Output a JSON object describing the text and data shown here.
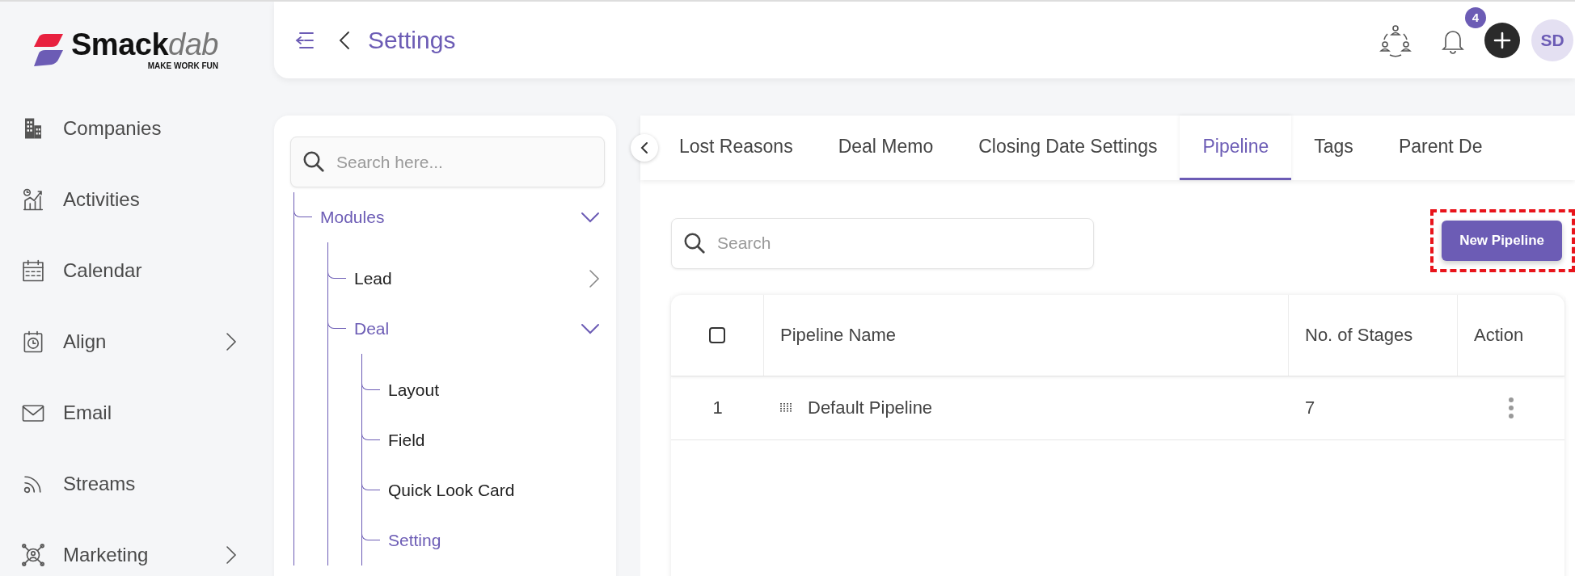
{
  "logo": {
    "name": "Smack",
    "name_accent": "dab",
    "tagline": "MAKE WORK FUN"
  },
  "sidebar": {
    "items": [
      {
        "label": "Companies",
        "expandable": false
      },
      {
        "label": "Activities",
        "expandable": false
      },
      {
        "label": "Calendar",
        "expandable": false
      },
      {
        "label": "Align",
        "expandable": true
      },
      {
        "label": "Email",
        "expandable": false
      },
      {
        "label": "Streams",
        "expandable": false
      },
      {
        "label": "Marketing",
        "expandable": true
      }
    ]
  },
  "header": {
    "title": "Settings",
    "notification_count": "4",
    "avatar_initials": "SD"
  },
  "tree": {
    "search": {
      "placeholder": "Search here..."
    },
    "items": [
      {
        "label": "Modules",
        "expanded": true,
        "children": [
          {
            "label": "Lead",
            "expanded": false
          },
          {
            "label": "Deal",
            "expanded": true,
            "children": [
              {
                "label": "Layout",
                "selected": false
              },
              {
                "label": "Field",
                "selected": false
              },
              {
                "label": "Quick Look Card",
                "selected": false
              },
              {
                "label": "Setting",
                "selected": true
              }
            ]
          }
        ]
      }
    ]
  },
  "tabs": [
    {
      "label": "Lost Reasons",
      "selected": false
    },
    {
      "label": "Deal Memo",
      "selected": false
    },
    {
      "label": "Closing Date Settings",
      "selected": false
    },
    {
      "label": "Pipeline",
      "selected": true
    },
    {
      "label": "Tags",
      "selected": false
    },
    {
      "label": "Parent De",
      "selected": false
    }
  ],
  "pipeline": {
    "search": {
      "placeholder": "Search"
    },
    "new_button": {
      "label": "New Pipeline",
      "highlighted": true
    },
    "table": {
      "select_all": {
        "checked": false
      },
      "columns": [
        "Pipeline Name",
        "No. of Stages",
        "Action"
      ],
      "rows": [
        {
          "index": "1",
          "name": "Default Pipeline",
          "stages": "7"
        }
      ]
    }
  }
}
